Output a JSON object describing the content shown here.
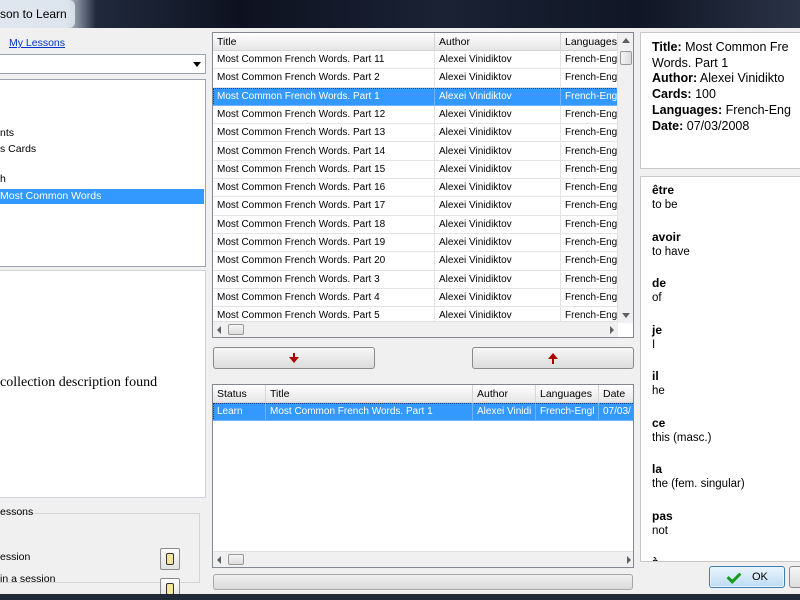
{
  "window": {
    "title": "son to Learn"
  },
  "left": {
    "my_lessons_link": "My Lessons",
    "tree_items": [
      {
        "label": "nts",
        "selected": false
      },
      {
        "label": "s Cards",
        "selected": false
      },
      {
        "label": "h",
        "selected": false
      },
      {
        "label": " Most Common Words",
        "selected": true
      }
    ],
    "description_text": "collection description found",
    "lessons_group_label": "essons",
    "option1": "ession",
    "option2": "in a session"
  },
  "top_grid": {
    "columns": [
      "Title",
      "Author",
      "Languages"
    ],
    "rows": [
      [
        "Most Common French Words. Part 11",
        "Alexei Vinidiktov",
        "French-Eng"
      ],
      [
        "Most Common French Words. Part 2",
        "Alexei Vinidiktov",
        "French-Eng"
      ],
      [
        "Most Common French Words. Part 1",
        "Alexei Vinidiktov",
        "French-Eng"
      ],
      [
        "Most Common French Words. Part 12",
        "Alexei Vinidiktov",
        "French-Eng"
      ],
      [
        "Most Common French Words. Part 13",
        "Alexei Vinidiktov",
        "French-Eng"
      ],
      [
        "Most Common French Words. Part 14",
        "Alexei Vinidiktov",
        "French-Eng"
      ],
      [
        "Most Common French Words. Part 15",
        "Alexei Vinidiktov",
        "French-Eng"
      ],
      [
        "Most Common French Words. Part 16",
        "Alexei Vinidiktov",
        "French-Eng"
      ],
      [
        "Most Common French Words. Part 17",
        "Alexei Vinidiktov",
        "French-Eng"
      ],
      [
        "Most Common French Words. Part 18",
        "Alexei Vinidiktov",
        "French-Eng"
      ],
      [
        "Most Common French Words. Part 19",
        "Alexei Vinidiktov",
        "French-Eng"
      ],
      [
        "Most Common French Words. Part 20",
        "Alexei Vinidiktov",
        "French-Eng"
      ],
      [
        "Most Common French Words. Part 3",
        "Alexei Vinidiktov",
        "French-Eng"
      ],
      [
        "Most Common French Words. Part 4",
        "Alexei Vinidiktov",
        "French-Eng"
      ],
      [
        "Most Common French Words. Part 5",
        "Alexei Vinidiktov",
        "French-Eng"
      ]
    ],
    "selected_index": 2
  },
  "bottom_grid": {
    "columns": [
      "Status",
      "Title",
      "Author",
      "Languages",
      "Date"
    ],
    "rows": [
      [
        "Learn",
        "Most Common French Words. Part 1",
        "Alexei Vinidi",
        "French-Engl",
        "07/03/"
      ]
    ],
    "selected_index": 0
  },
  "info": {
    "title_label": "Title:",
    "title_value": "Most Common Fre",
    "title_value2": "Words. Part 1",
    "author_label": "Author:",
    "author_value": "Alexei Vinidikto",
    "cards_label": "Cards:",
    "cards_value": "100",
    "languages_label": "Languages:",
    "languages_value": "French-Eng",
    "date_label": "Date:",
    "date_value": "07/03/2008"
  },
  "words": [
    {
      "word": "être",
      "translation": "to be"
    },
    {
      "word": "avoir",
      "translation": "to have"
    },
    {
      "word": "de",
      "translation": "of"
    },
    {
      "word": "je",
      "translation": "I"
    },
    {
      "word": "il",
      "translation": "he"
    },
    {
      "word": "ce",
      "translation": "this (masc.)"
    },
    {
      "word": "la",
      "translation": "the (fem. singular)"
    },
    {
      "word": "pas",
      "translation": "not"
    },
    {
      "word": "à",
      "translation": ""
    }
  ],
  "buttons": {
    "ok": "OK"
  },
  "colors": {
    "selection": "#3399ff",
    "link": "#0033cc",
    "arrow_red": "#aa0000",
    "check_green": "#1a9c1a"
  },
  "icons": {
    "move_down": "arrow-down-icon",
    "move_up": "arrow-up-icon",
    "ok": "checkmark-icon",
    "combo": "chevron-down-icon"
  }
}
